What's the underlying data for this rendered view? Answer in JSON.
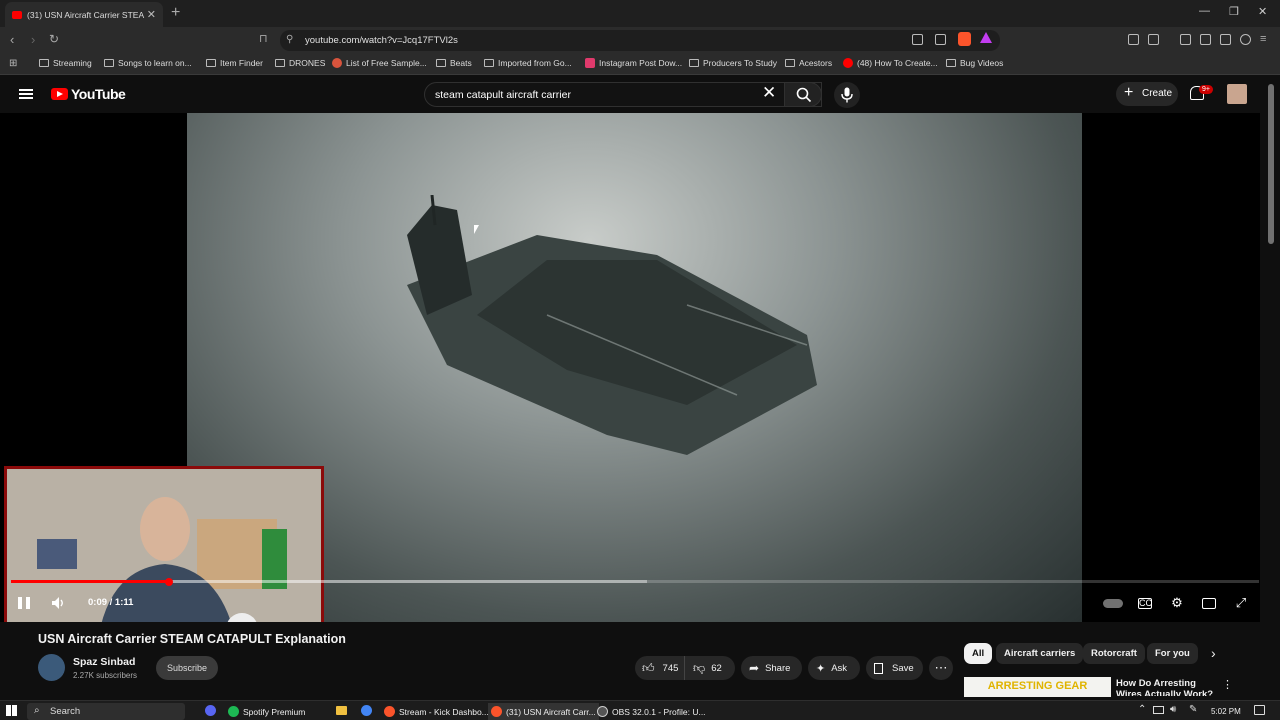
{
  "browser": {
    "tab_title": "(31) USN Aircraft Carrier STEA",
    "url": "youtube.com/watch?v=Jcq17FTVl2s",
    "bookmarks": [
      {
        "label": "Streaming",
        "icon": "folder"
      },
      {
        "label": "Songs to learn on...",
        "icon": "folder"
      },
      {
        "label": "Item Finder",
        "icon": "folder"
      },
      {
        "label": "DRONES",
        "icon": "folder"
      },
      {
        "label": "List of Free Sample...",
        "icon": "site"
      },
      {
        "label": "Beats",
        "icon": "folder"
      },
      {
        "label": "Imported from Go...",
        "icon": "folder"
      },
      {
        "label": "Instagram Post Dow...",
        "icon": "site"
      },
      {
        "label": "Producers To Study",
        "icon": "folder"
      },
      {
        "label": "Acestors",
        "icon": "folder"
      },
      {
        "label": "(48) How To Create...",
        "icon": "youtube"
      },
      {
        "label": "Bug Videos",
        "icon": "folder"
      }
    ]
  },
  "header": {
    "logo_text": "YouTube",
    "search_value": "steam catapult aircraft carrier",
    "create_label": "Create",
    "notif_badge": "9+"
  },
  "player": {
    "current_time": "0:09 / 1:11",
    "progress_fraction": 0.127,
    "buffered_fraction": 0.51
  },
  "video": {
    "title": "USN Aircraft Carrier STEAM CATAPULT Explanation",
    "channel": "Spaz Sinbad",
    "subscribers": "2.27K subscribers",
    "subscribe_label": "Subscribe",
    "likes": "745",
    "dislikes": "62",
    "share_label": "Share",
    "ask_label": "Ask",
    "save_label": "Save"
  },
  "chips": [
    "All",
    "Aircraft carriers",
    "Rotorcraft",
    "For you"
  ],
  "related": {
    "thumb_text": "ARRESTING GEAR",
    "title": "How Do Arresting Wires Actually Work? (It's N..."
  },
  "taskbar": {
    "search_label": "Search",
    "items": [
      {
        "label": "Spotify Premium",
        "color": "#1db954"
      },
      {
        "label": "Stream - Kick Dashbo...",
        "color": "#fb542b"
      },
      {
        "label": "(31) USN Aircraft Carr...",
        "color": "#fb542b"
      },
      {
        "label": "OBS 32.0.1 - Profile: U...",
        "color": "#555555"
      }
    ],
    "clock": "5:02 PM"
  },
  "colors": {
    "accent": "#ff0000",
    "background": "#0f0f0f"
  }
}
